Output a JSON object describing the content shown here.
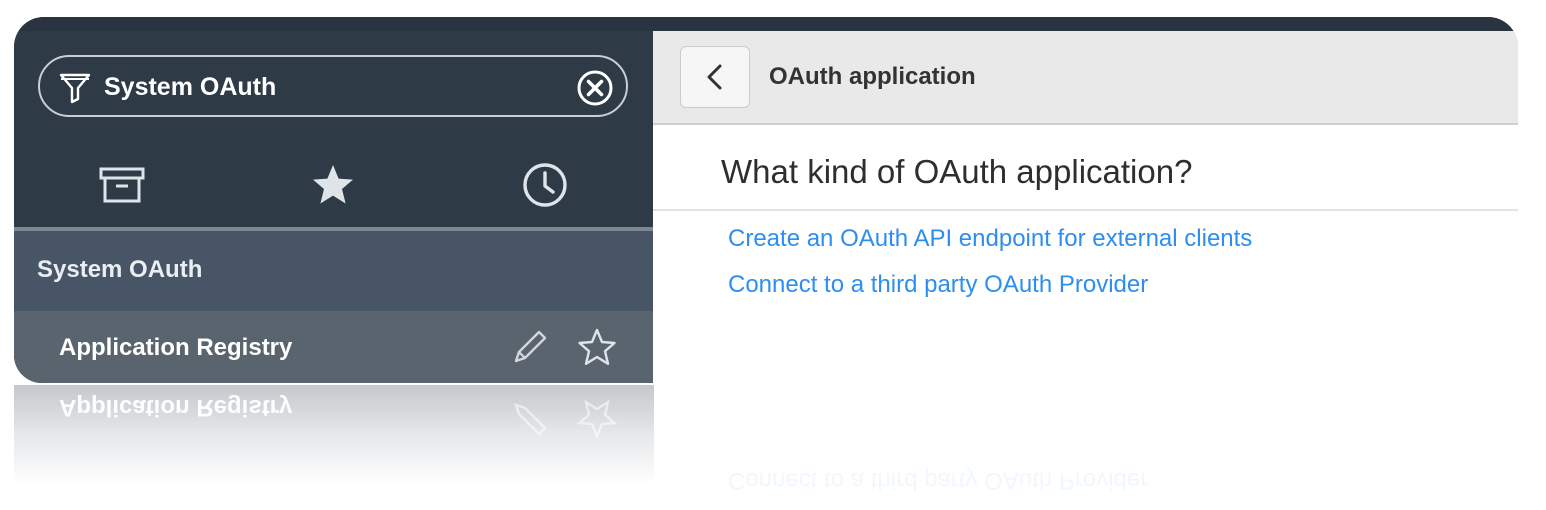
{
  "filter": {
    "value": "System OAuth",
    "icons": {
      "filter": "filter-funnel-icon",
      "clear": "clear-circle-x-icon"
    }
  },
  "nav_tabs": [
    {
      "icon": "archive-box-icon",
      "tooltip": ""
    },
    {
      "icon": "star-filled-icon",
      "tooltip": ""
    },
    {
      "icon": "clock-icon",
      "tooltip": ""
    }
  ],
  "sidebar": {
    "section_title": "System OAuth",
    "items": [
      {
        "label": "Application Registry",
        "icons": [
          "pencil-edit-icon",
          "star-outline-icon"
        ]
      }
    ]
  },
  "content": {
    "header_title": "OAuth application",
    "question": "What kind of OAuth application?",
    "links": [
      "Create an OAuth API endpoint for external clients",
      "Connect to a third party OAuth Provider"
    ]
  },
  "colors": {
    "sidebar_bg": "#2f3a47",
    "section_bg": "#475566",
    "item_bg": "#5a646e",
    "link": "#2d8ef0",
    "header_bg": "#e9e9e9"
  }
}
